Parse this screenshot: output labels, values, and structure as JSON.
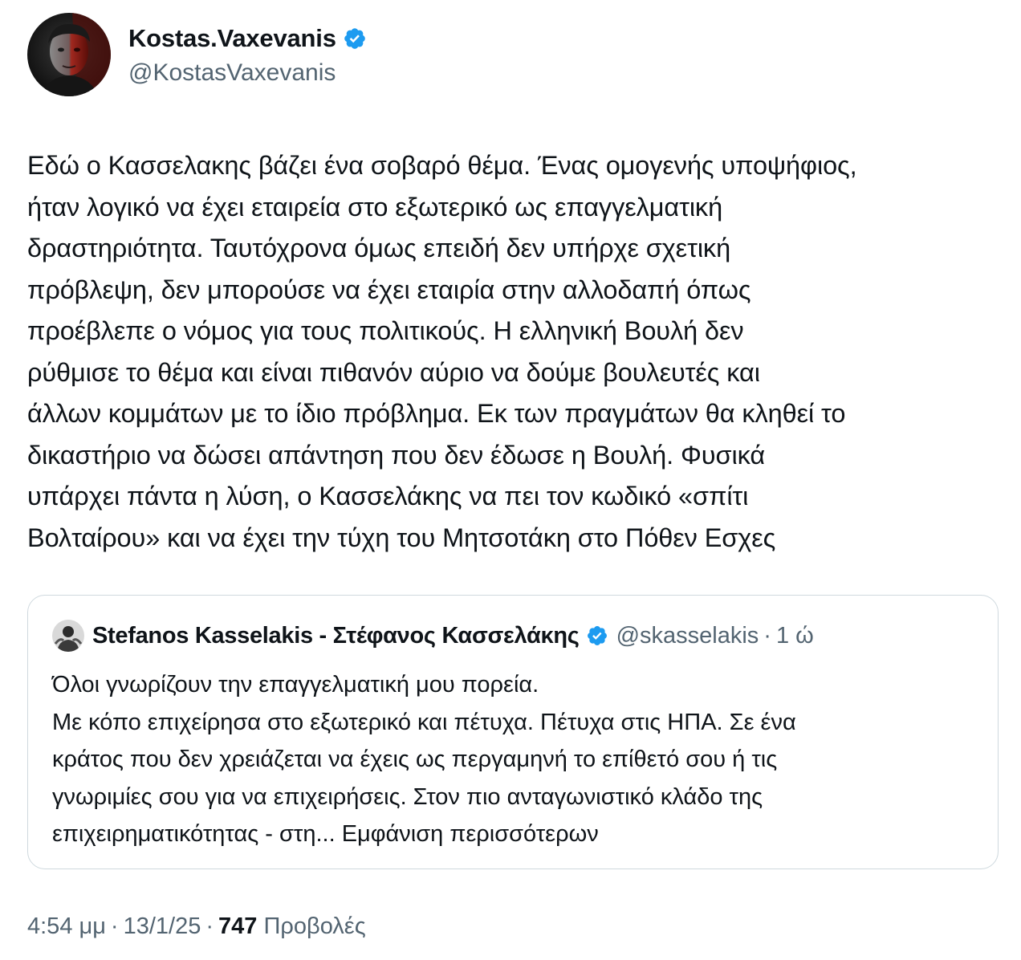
{
  "author": {
    "display_name": "Kostas.Vaxevanis",
    "handle": "@KostasVaxevanis",
    "verified": true,
    "avatar_icon": "profile-photo-dark-red-portrait"
  },
  "tweet": {
    "text": "Εδώ ο Κασσελακης βάζει ένα σοβαρό θέμα. Ένας ομογενής υποψήφιος,\nήταν λογικό να έχει εταιρεία στο εξωτερικό ως επαγγελματική\nδραστηριότητα. Ταυτόχρονα όμως επειδή δεν υπήρχε σχετική\nπρόβλεψη, δεν μπορούσε να έχει εταιρία στην αλλοδαπή όπως\nπροέβλεπε ο νόμος για τους πολιτικούς. Η ελληνική Βουλή δεν\nρύθμισε το θέμα και είναι πιθανόν αύριο να δούμε βουλευτές και\nάλλων κομμάτων με το ίδιο πρόβλημα. Εκ των πραγμάτων θα κληθεί το\nδικαστήριο να δώσει απάντηση που δεν έδωσε η Βουλή. Φυσικά\nυπάρχει πάντα η λύση, ο Κασσελάκης να πει τον κωδικό «σπίτι\nΒολταίρου» και να έχει την τύχη του Μητσοτάκη στο Πόθεν Εσχες"
  },
  "quoted_tweet": {
    "display_name": "Stefanos Kasselakis - Στέφανος Κασσελάκης",
    "handle": "@skasselakis",
    "separator": "·",
    "time": "1 ώ",
    "verified": true,
    "avatar_icon": "profile-photo-grayscale-portrait",
    "text": "Όλοι γνωρίζουν την επαγγελματική μου πορεία.\nΜε κόπο επιχείρησα στο εξωτερικό και πέτυχα. Πέτυχα στις ΗΠΑ. Σε ένα\nκράτος που δεν χρειάζεται να έχεις ως περγαμηνή το επίθετό σου ή τις\nγνωριμίες σου για να επιχειρήσεις. Στον πιο ανταγωνιστικό κλάδο της\nεπιχειρηματικότητας - στη... ",
    "show_more": "Εμφάνιση περισσότερων"
  },
  "meta": {
    "time": "4:54 μμ",
    "separator": "·",
    "date": "13/1/25",
    "views_count": "747",
    "views_label": "Προβολές"
  },
  "colors": {
    "text_primary": "#0f1419",
    "text_secondary": "#536471",
    "verified_blue": "#1d9bf0",
    "border": "#cfd9de"
  }
}
